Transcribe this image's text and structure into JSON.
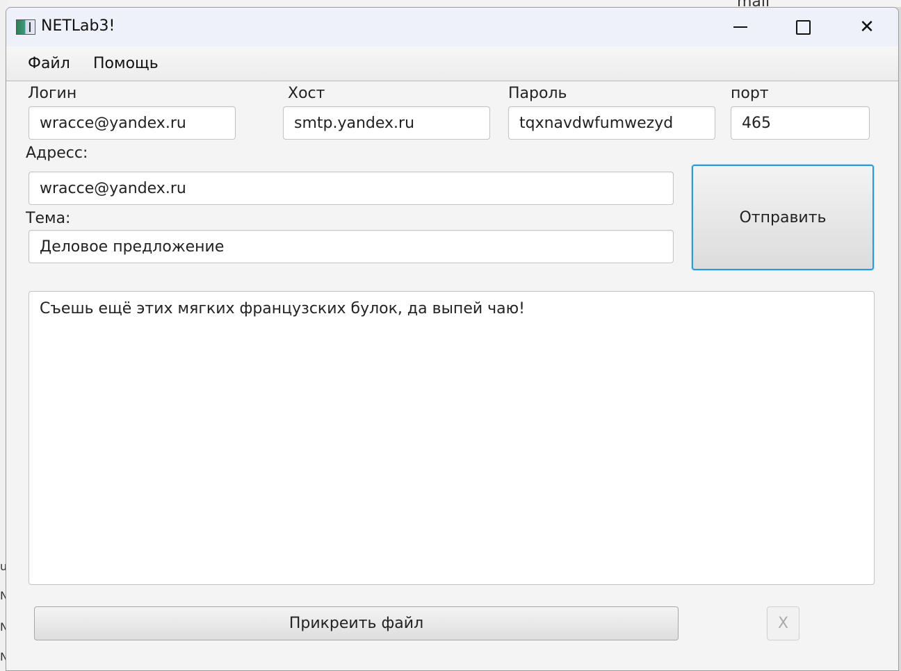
{
  "background": {
    "right_text": "mail",
    "left_letters": [
      "u",
      "N",
      "N",
      "N"
    ]
  },
  "window": {
    "title": "NETLab3!",
    "icon": "app-window-icon",
    "controls": {
      "minimize_icon": "minimize-icon",
      "maximize_icon": "maximize-icon",
      "close_icon": "close-icon",
      "close_glyph": "✕"
    }
  },
  "menu": {
    "items": [
      "Файл",
      "Помощь"
    ]
  },
  "form": {
    "login_label": "Логин",
    "login_value": "wracce@yandex.ru",
    "host_label": "Хост",
    "host_value": "smtp.yandex.ru",
    "password_label": "Пароль",
    "password_value": "tqxnavdwfumwezyd",
    "port_label": "порт",
    "port_value": "465",
    "address_label": "Адресс:",
    "address_value": "wracce@yandex.ru",
    "subject_label": "Тема:",
    "subject_value": "Деловое предложение",
    "send_label": "Отправить",
    "body_value": "Съешь ещё этих мягких французских булок, да выпей чаю!",
    "attach_label": "Прикреить файл",
    "remove_label": "X"
  },
  "colors": {
    "focus_border": "#2a9bd6",
    "titlebar_bg": "#eef1f9",
    "window_bg": "#f4f4f4"
  }
}
